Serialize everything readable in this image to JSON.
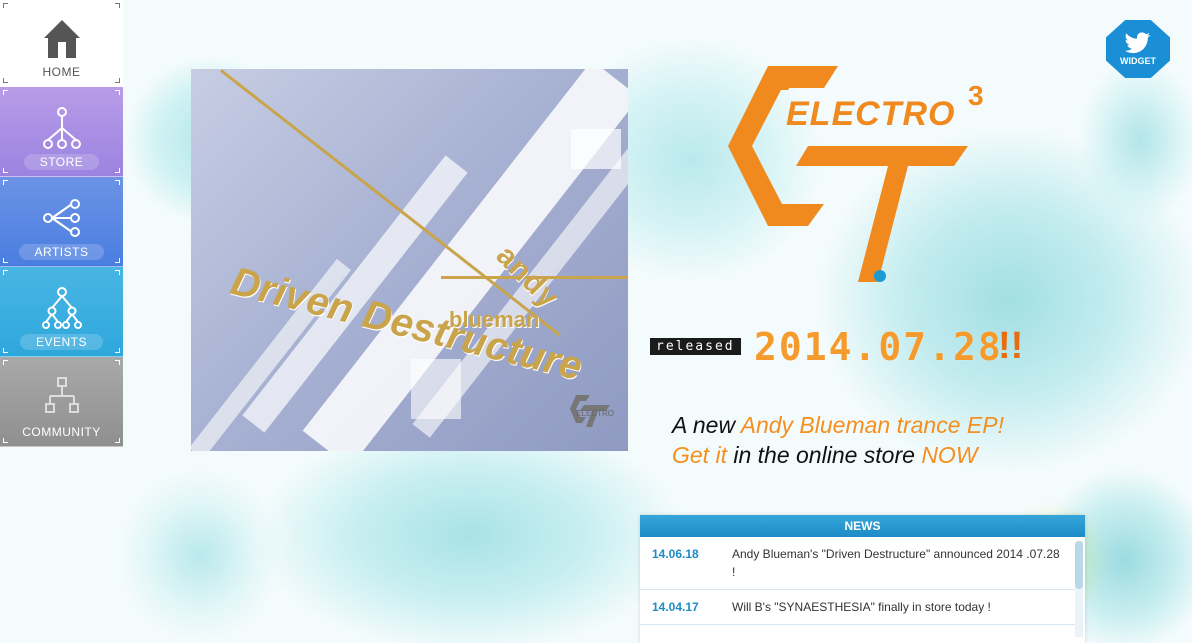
{
  "nav": {
    "home": "HOME",
    "store": "STORE",
    "artists": "ARTISTS",
    "events": "EVENTS",
    "community": "COMMUNITY"
  },
  "album": {
    "artist_line1": "andy",
    "artist_line2": "blueman",
    "title": "Driven Destructure",
    "logo_text": "ELECTRO"
  },
  "logo": {
    "word": "ELECTRO",
    "superscript": "3"
  },
  "release": {
    "label": "released",
    "date": "2014.07.28",
    "bang": "!!"
  },
  "tagline": {
    "line1_prefix": "A new ",
    "line1_highlight": "Andy Blueman trance EP!",
    "line2_highlight_a": "Get it",
    "line2_middle": " in the online store ",
    "line2_highlight_b": "NOW"
  },
  "twitter": {
    "label": "WIDGET"
  },
  "news": {
    "header": "NEWS",
    "items": [
      {
        "date": "14.06.18",
        "text": "Andy Blueman's \"Driven Destructure\" announced 2014 .07.28 !"
      },
      {
        "date": "14.04.17",
        "text": "Will B's \"SYNAESTHESIA\" finally in store today !"
      }
    ]
  },
  "colors": {
    "orange": "#f08a1f",
    "news_blue": "#1d8bc8",
    "twitter_blue": "#1b8fd6"
  }
}
